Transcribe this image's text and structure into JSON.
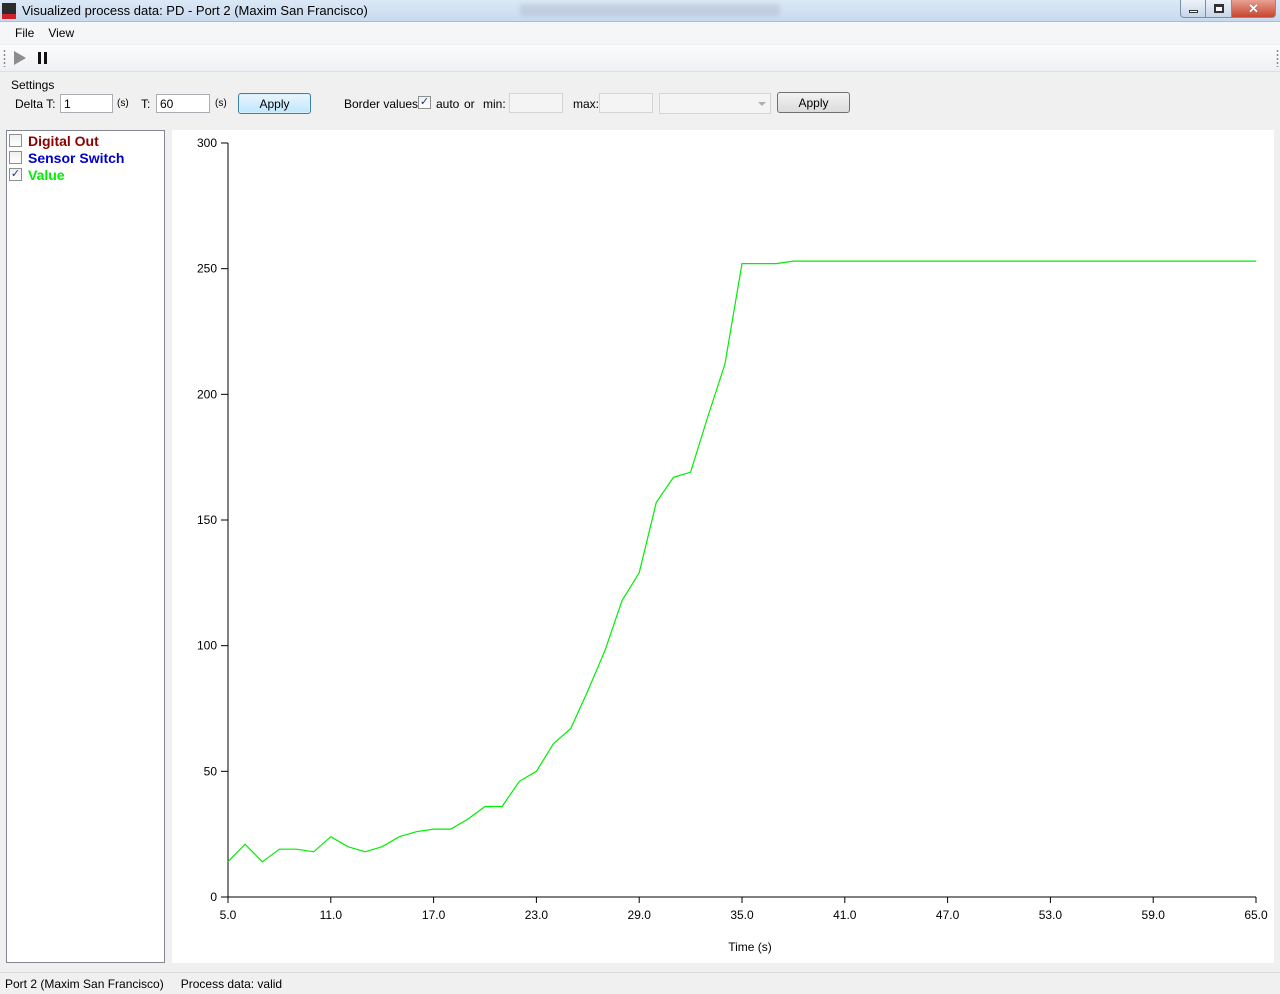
{
  "window": {
    "title": "Visualized process data: PD - Port 2 (Maxim San Francisco)"
  },
  "menu": {
    "items": [
      {
        "label": "File"
      },
      {
        "label": "View"
      }
    ]
  },
  "toolbar": {
    "play_icon": "play-icon",
    "pause_icon": "pause-icon"
  },
  "settings": {
    "group_label": "Settings",
    "delta_t_label": "Delta T:",
    "delta_t_value": "1",
    "delta_t_unit": "(s)",
    "t_label": "T:",
    "t_value": "60",
    "t_unit": "(s)",
    "apply_label": "Apply",
    "border_values_label": "Border values:",
    "auto_checked": true,
    "auto_label": "auto",
    "or_label": "or",
    "min_label": "min:",
    "min_value": "",
    "max_label": "max:",
    "max_value": "",
    "combo_value": "",
    "apply2_label": "Apply"
  },
  "series_list": [
    {
      "label": "Digital Out",
      "checked": false,
      "color": "#8b0000"
    },
    {
      "label": "Sensor Switch",
      "checked": false,
      "color": "#0000cd"
    },
    {
      "label": "Value",
      "checked": true,
      "color": "#00ee00"
    }
  ],
  "chart_data": {
    "type": "line",
    "xlabel": "Time (s)",
    "ylabel": "",
    "xlim": [
      5,
      65
    ],
    "ylim": [
      0,
      300
    ],
    "x_ticks": [
      "5.0",
      "11.0",
      "17.0",
      "23.0",
      "29.0",
      "35.0",
      "41.0",
      "47.0",
      "53.0",
      "59.0",
      "65.0"
    ],
    "y_ticks": [
      "0",
      "50",
      "100",
      "150",
      "200",
      "250",
      "300"
    ],
    "grid": false,
    "series": [
      {
        "name": "Value",
        "color": "#00ee00",
        "x": [
          5,
          6,
          7,
          8,
          9,
          10,
          11,
          12,
          13,
          14,
          15,
          16,
          17,
          18,
          19,
          20,
          21,
          22,
          23,
          24,
          25,
          26,
          27,
          28,
          29,
          30,
          31,
          32,
          33,
          34,
          35,
          36,
          37,
          38,
          39,
          40,
          41,
          42,
          43,
          44,
          45,
          46,
          47,
          48,
          49,
          50,
          51,
          52,
          53,
          54,
          55,
          56,
          57,
          58,
          59,
          60,
          61,
          62,
          63,
          64,
          65
        ],
        "values": [
          14,
          21,
          14,
          19,
          19,
          18,
          24,
          20,
          18,
          20,
          24,
          26,
          27,
          27,
          31,
          36,
          36,
          46,
          50,
          61,
          67,
          82,
          98,
          118,
          129,
          157,
          167,
          169,
          191,
          212,
          252,
          252,
          252,
          253,
          253,
          253,
          253,
          253,
          253,
          253,
          253,
          253,
          253,
          253,
          253,
          253,
          253,
          253,
          253,
          253,
          253,
          253,
          253,
          253,
          253,
          253,
          253,
          253,
          253,
          253,
          253
        ]
      }
    ]
  },
  "status": {
    "port": "Port 2 (Maxim San Francisco)",
    "process": "Process data: valid"
  }
}
